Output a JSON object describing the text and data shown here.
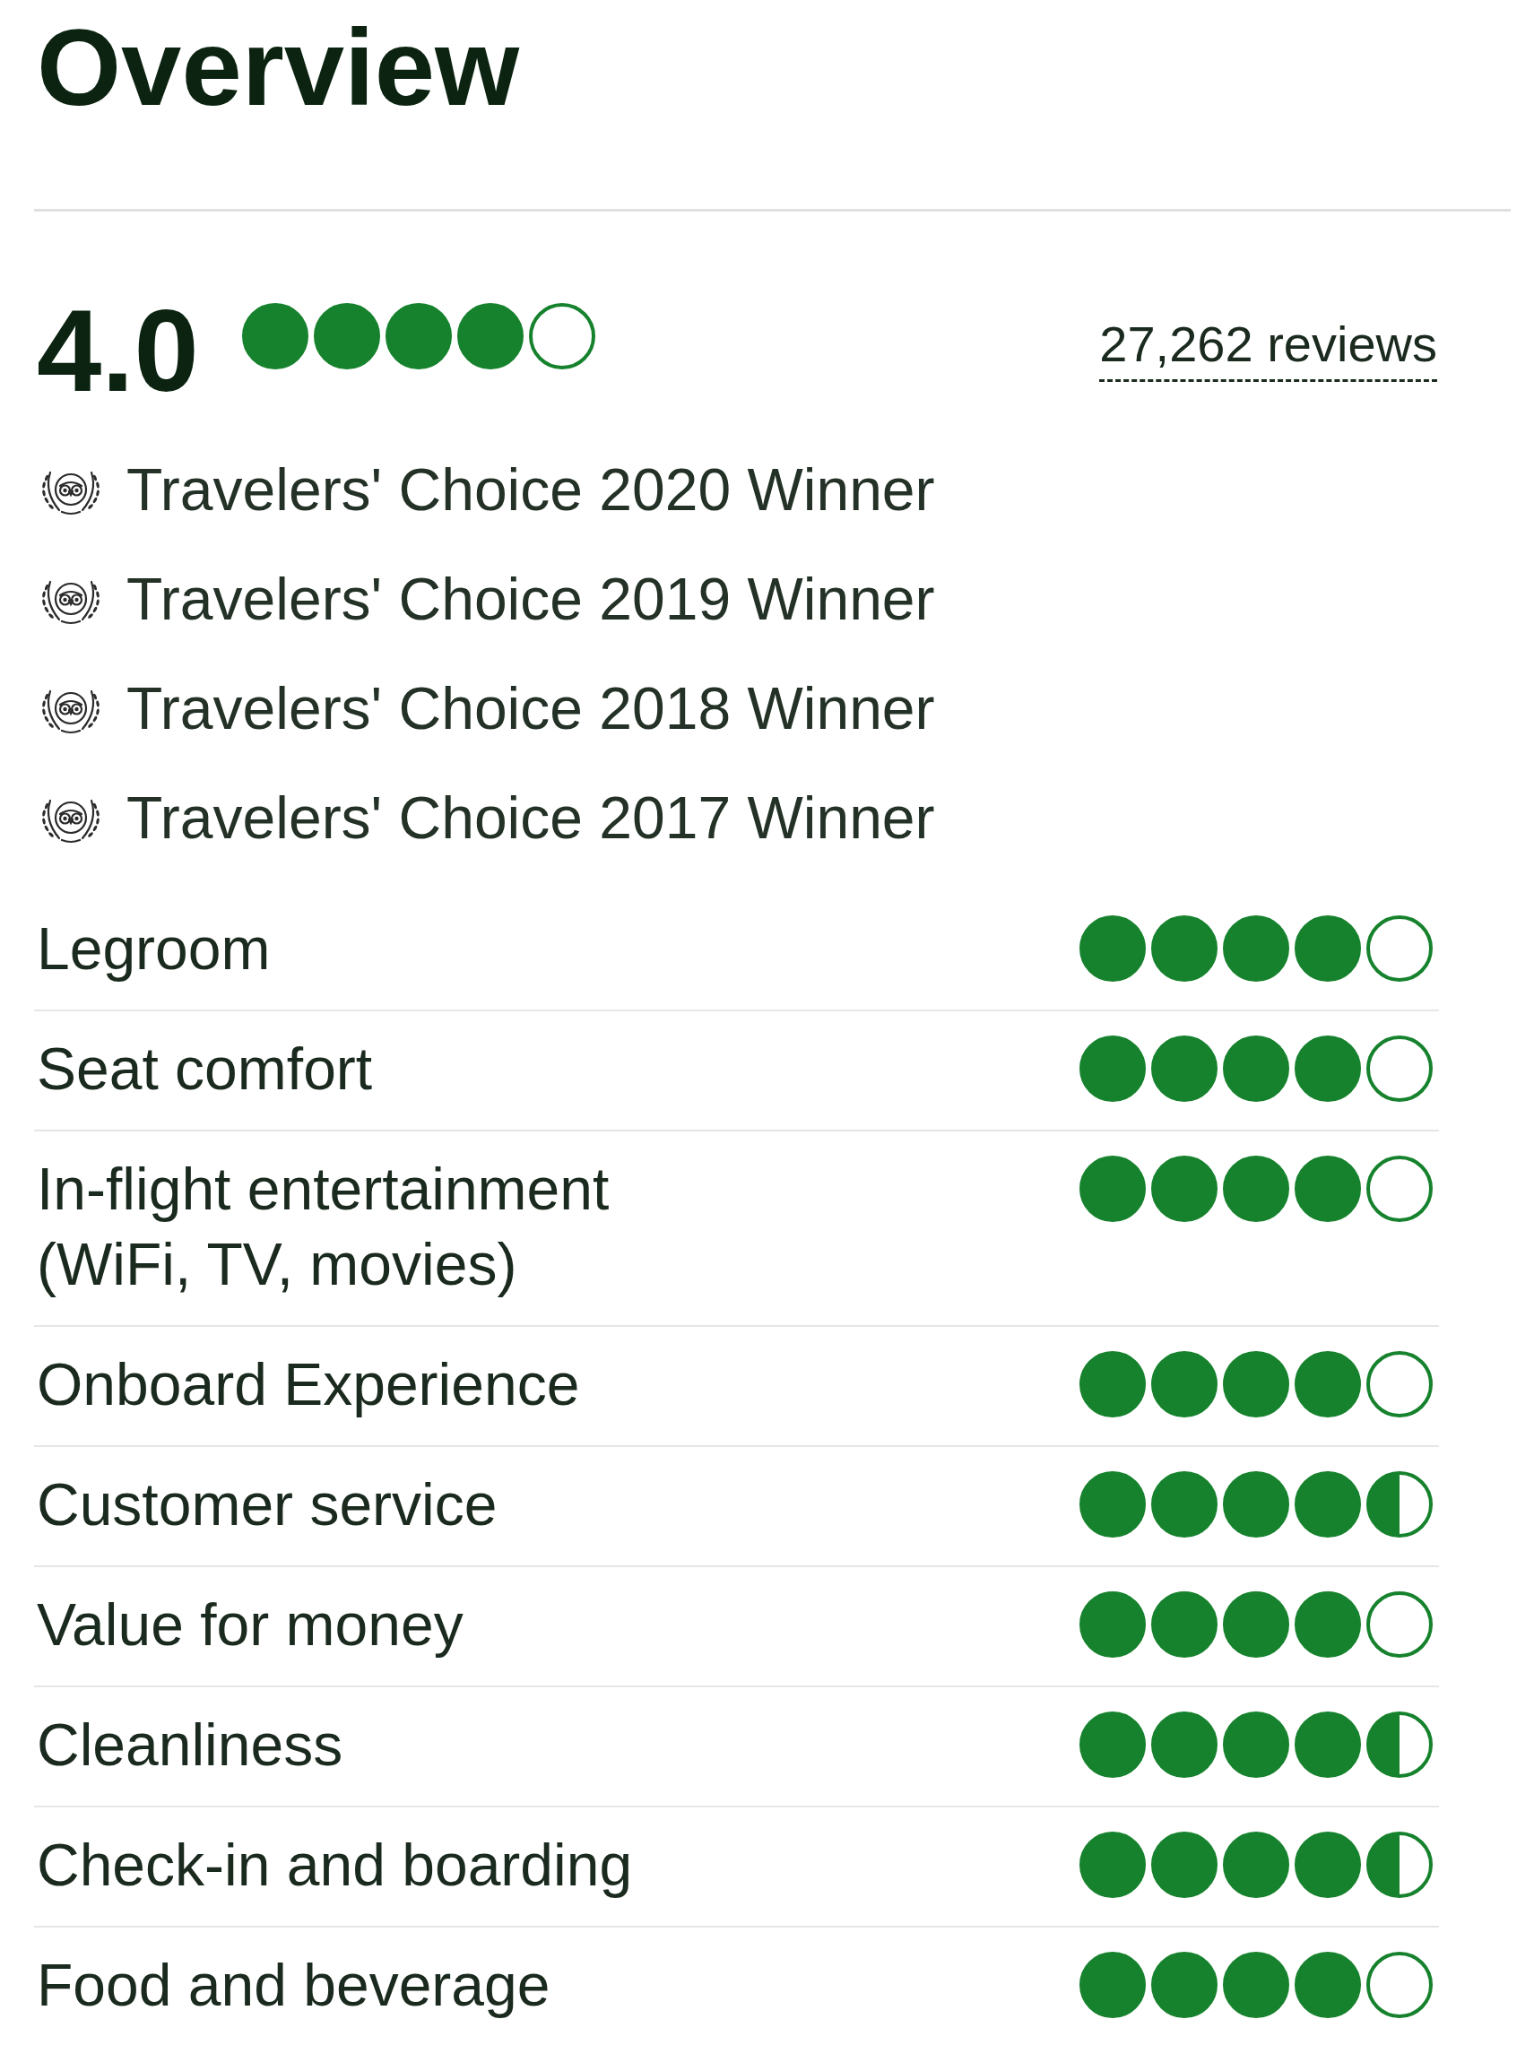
{
  "title": "Overview",
  "summary": {
    "score": "4.0",
    "stars": 4,
    "reviews": "27,262 reviews"
  },
  "awards": [
    "Travelers' Choice 2020 Winner",
    "Travelers' Choice 2019 Winner",
    "Travelers' Choice 2018 Winner",
    "Travelers' Choice 2017 Winner"
  ],
  "ratings": [
    {
      "label": "Legroom",
      "stars": 4
    },
    {
      "label": "Seat comfort",
      "stars": 4
    },
    {
      "label": "In-flight entertainment (WiFi, TV, movies)",
      "stars": 4
    },
    {
      "label": "Onboard Experience",
      "stars": 4
    },
    {
      "label": "Customer service",
      "stars": 4.5
    },
    {
      "label": "Value for money",
      "stars": 4
    },
    {
      "label": "Cleanliness",
      "stars": 4.5
    },
    {
      "label": "Check-in and boarding",
      "stars": 4.5
    },
    {
      "label": "Food and beverage",
      "stars": 4
    }
  ]
}
